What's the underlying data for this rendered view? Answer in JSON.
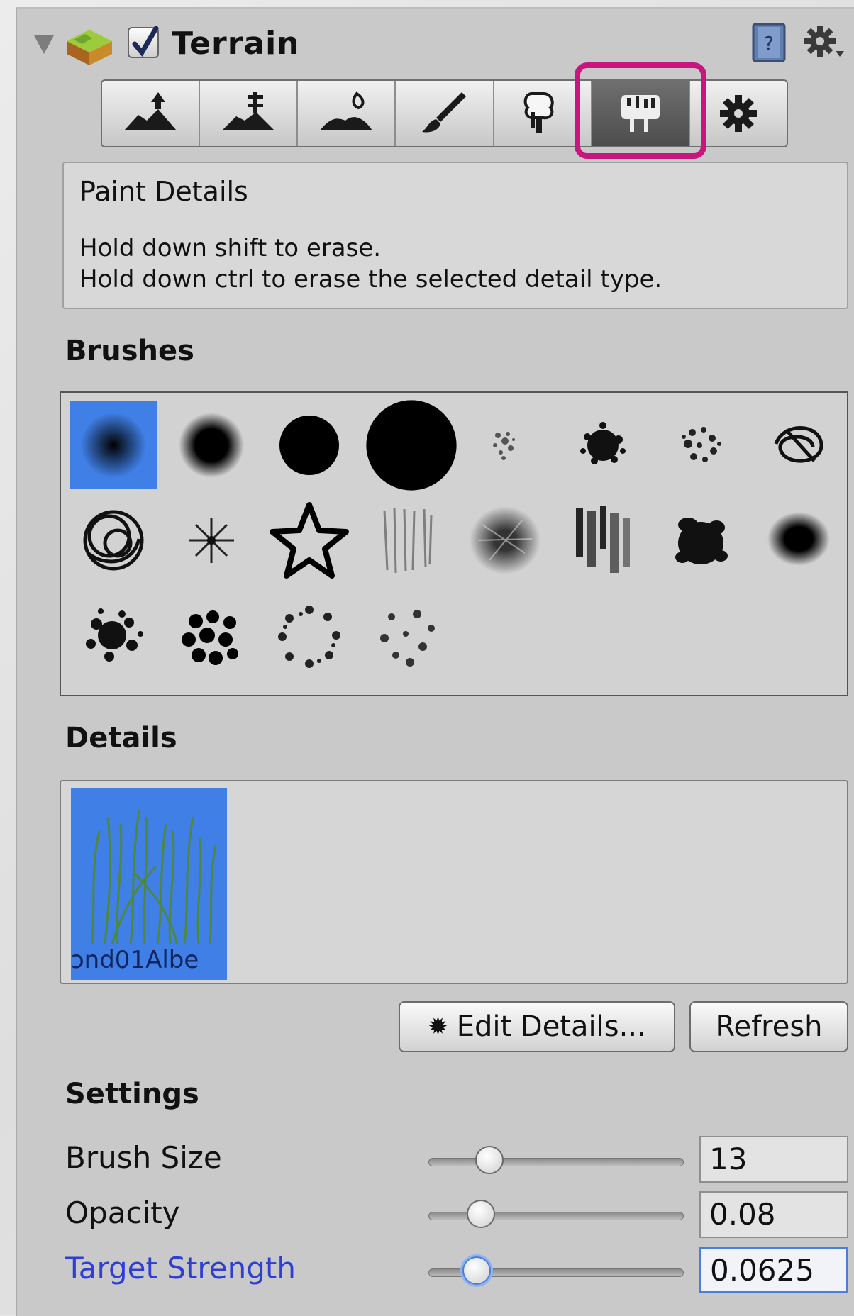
{
  "header": {
    "title": "Terrain",
    "enabled": true,
    "icons": [
      "terrain-object-icon",
      "help-book-icon",
      "gear-dropdown-icon"
    ]
  },
  "toolbar": {
    "tools": [
      {
        "name": "raise-lower-terrain-icon",
        "active": false
      },
      {
        "name": "paint-height-icon",
        "active": false
      },
      {
        "name": "smooth-height-icon",
        "active": false
      },
      {
        "name": "paint-texture-icon",
        "active": false
      },
      {
        "name": "place-trees-icon",
        "active": false
      },
      {
        "name": "paint-details-icon",
        "active": true
      },
      {
        "name": "terrain-settings-icon",
        "active": false
      }
    ],
    "highlight_color": "#c7177f"
  },
  "info": {
    "title": "Paint Details",
    "line1": "Hold down shift to erase.",
    "line2": "Hold down ctrl to erase the selected detail type."
  },
  "brushes": {
    "heading": "Brushes",
    "items": [
      "soft-round-brush",
      "medium-round-brush",
      "hard-round-brush",
      "large-hard-round-brush",
      "sparse-noise-brush",
      "dense-noise-brush",
      "speckle-noise-brush",
      "scribble-noise-brush",
      "swirl-brush",
      "starburst-brush",
      "star-outline-brush",
      "streak-brush",
      "grain-brush",
      "vertical-streak-brush",
      "splat-brush",
      "soft-blot-brush",
      "scatter-splat-brush",
      "dots-brush",
      "ring-scatter-brush",
      "sparse-dots-brush"
    ],
    "selected_index": 0,
    "selection_color": "#3f7fe6"
  },
  "details": {
    "heading": "Details",
    "items": [
      {
        "name": "ɔnd01Albe",
        "selected": true
      }
    ],
    "edit_button": "Edit Details...",
    "refresh_button": "Refresh"
  },
  "settings": {
    "heading": "Settings",
    "brush_size": {
      "label": "Brush Size",
      "value": "13",
      "slider_fraction": 0.12
    },
    "opacity": {
      "label": "Opacity",
      "value": "0.08",
      "slider_fraction": 0.08
    },
    "target_strength": {
      "label": "Target Strength",
      "value": "0.0625",
      "slider_fraction": 0.06,
      "focused": true
    }
  }
}
